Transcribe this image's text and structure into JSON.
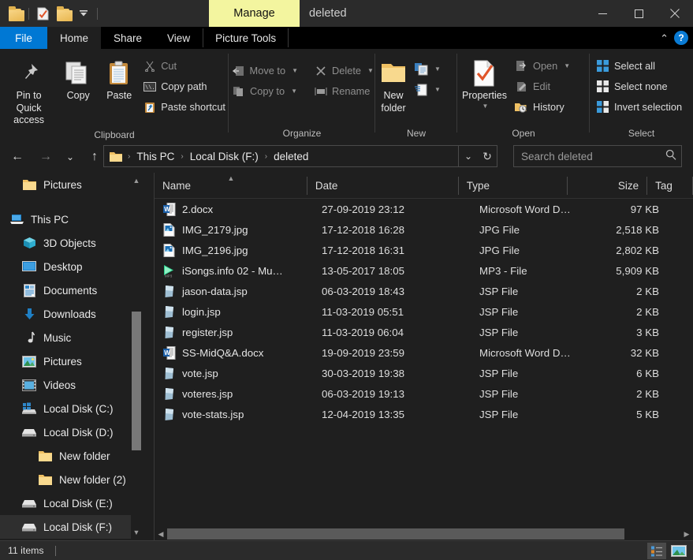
{
  "window": {
    "title": "deleted",
    "contextual_tab": "Manage",
    "quick_access": [
      {
        "name": "folder-icon",
        "label": "Folder"
      },
      {
        "name": "properties-icon",
        "label": "Properties"
      },
      {
        "name": "new-folder-icon",
        "label": "New folder"
      },
      {
        "name": "customize-qat-icon",
        "label": "Customize Quick Access Toolbar"
      }
    ],
    "controls": {
      "minimize": "Minimize",
      "maximize": "Maximize",
      "close": "Close"
    }
  },
  "tabs": [
    {
      "label": "File",
      "id": "file"
    },
    {
      "label": "Home",
      "id": "home"
    },
    {
      "label": "Share",
      "id": "share"
    },
    {
      "label": "View",
      "id": "view"
    },
    {
      "label": "Picture Tools",
      "id": "picture-tools"
    }
  ],
  "ribbon_right": {
    "collapse": "⌃",
    "help": "?"
  },
  "ribbon": {
    "groups": [
      {
        "label": "Clipboard",
        "big": [
          {
            "name": "pin-to-quick-access-button",
            "label": "Pin to Quick\naccess",
            "line1": "Pin to Quick",
            "line2": "access",
            "icon": "pin-icon"
          },
          {
            "name": "copy-button",
            "label": "Copy",
            "line1": "Copy",
            "line2": "",
            "icon": "copy-icon"
          },
          {
            "name": "paste-button",
            "label": "Paste",
            "line1": "Paste",
            "line2": "",
            "icon": "paste-icon"
          }
        ],
        "small": [
          {
            "name": "cut-button",
            "label": "Cut",
            "icon": "scissors-icon",
            "dim": true,
            "caret": false
          },
          {
            "name": "copy-path-button",
            "label": "Copy path",
            "icon": "copy-path-icon",
            "dim": false,
            "caret": false
          },
          {
            "name": "paste-shortcut-button",
            "label": "Paste shortcut",
            "icon": "paste-shortcut-icon",
            "dim": false,
            "caret": false
          }
        ]
      },
      {
        "label": "Organize",
        "big": [],
        "small": [
          {
            "name": "move-to-button",
            "label": "Move to",
            "icon": "move-to-icon",
            "dim": true,
            "caret": true
          },
          {
            "name": "copy-to-button",
            "label": "Copy to",
            "icon": "copy-to-icon",
            "dim": true,
            "caret": true
          },
          {
            "name": "delete-button",
            "label": "Delete",
            "icon": "delete-icon",
            "dim": true,
            "caret": true
          },
          {
            "name": "rename-button",
            "label": "Rename",
            "icon": "rename-icon",
            "dim": true,
            "caret": false
          }
        ]
      },
      {
        "label": "New",
        "big": [
          {
            "name": "new-folder-button",
            "label": "New folder",
            "line1": "New",
            "line2": "folder",
            "icon": "folder-icon"
          }
        ],
        "small": [
          {
            "name": "new-item-button",
            "label": "",
            "icon": "new-item-icon",
            "dim": false,
            "caret": true
          },
          {
            "name": "easy-access-button",
            "label": "",
            "icon": "easy-access-icon",
            "dim": false,
            "caret": true
          }
        ]
      },
      {
        "label": "Open",
        "big": [
          {
            "name": "properties-button",
            "label": "Properties",
            "line1": "Properties",
            "line2": "",
            "icon": "properties-icon"
          }
        ],
        "small": [
          {
            "name": "open-button",
            "label": "Open",
            "icon": "open-icon",
            "dim": true,
            "caret": true
          },
          {
            "name": "edit-button",
            "label": "Edit",
            "icon": "edit-icon",
            "dim": true,
            "caret": false
          },
          {
            "name": "history-button",
            "label": "History",
            "icon": "history-icon",
            "dim": false,
            "caret": false
          }
        ]
      },
      {
        "label": "Select",
        "big": [],
        "small": [
          {
            "name": "select-all-button",
            "label": "Select all",
            "icon": "select-all-icon",
            "dim": false,
            "caret": false
          },
          {
            "name": "select-none-button",
            "label": "Select none",
            "icon": "select-none-icon",
            "dim": false,
            "caret": false
          },
          {
            "name": "invert-selection-button",
            "label": "Invert selection",
            "icon": "invert-selection-icon",
            "dim": false,
            "caret": false
          }
        ]
      }
    ]
  },
  "address": {
    "back": "←",
    "forward": "→",
    "recent": "⌄",
    "up": "↑",
    "breadcrumbs": [
      "This PC",
      "Local Disk (F:)",
      "deleted"
    ],
    "separator": "›",
    "dropdown": "⌄",
    "refresh": "↻"
  },
  "search": {
    "placeholder": "Search deleted",
    "value": "",
    "icon": "search-icon"
  },
  "sidebar": {
    "items": [
      {
        "label": "Pictures",
        "icon": "folder-icon",
        "level": 1,
        "selected": false,
        "gap_after": true
      },
      {
        "label": "This PC",
        "icon": "this-pc-icon",
        "level": 0,
        "selected": false,
        "gap_after": false
      },
      {
        "label": "3D Objects",
        "icon": "3d-objects-icon",
        "level": 1,
        "selected": false,
        "gap_after": false
      },
      {
        "label": "Desktop",
        "icon": "desktop-icon",
        "level": 1,
        "selected": false,
        "gap_after": false
      },
      {
        "label": "Documents",
        "icon": "documents-icon",
        "level": 1,
        "selected": false,
        "gap_after": false
      },
      {
        "label": "Downloads",
        "icon": "downloads-icon",
        "level": 1,
        "selected": false,
        "gap_after": false
      },
      {
        "label": "Music",
        "icon": "music-icon",
        "level": 1,
        "selected": false,
        "gap_after": false
      },
      {
        "label": "Pictures",
        "icon": "pictures-icon",
        "level": 1,
        "selected": false,
        "gap_after": false
      },
      {
        "label": "Videos",
        "icon": "videos-icon",
        "level": 1,
        "selected": false,
        "gap_after": false
      },
      {
        "label": "Local Disk (C:)",
        "icon": "windows-drive-icon",
        "level": 1,
        "selected": false,
        "gap_after": false
      },
      {
        "label": "Local Disk (D:)",
        "icon": "drive-icon",
        "level": 1,
        "selected": false,
        "gap_after": false
      },
      {
        "label": "New folder",
        "icon": "folder-icon",
        "level": 2,
        "selected": false,
        "gap_after": false
      },
      {
        "label": "New folder (2)",
        "icon": "folder-icon",
        "level": 2,
        "selected": false,
        "gap_after": false
      },
      {
        "label": "Local Disk (E:)",
        "icon": "drive-icon",
        "level": 1,
        "selected": false,
        "gap_after": false
      },
      {
        "label": "Local Disk (F:)",
        "icon": "drive-icon",
        "level": 1,
        "selected": true,
        "gap_after": false
      }
    ]
  },
  "filelist": {
    "columns": [
      {
        "label": "Name",
        "key": "name",
        "sorted": "asc"
      },
      {
        "label": "Date",
        "key": "date",
        "sorted": ""
      },
      {
        "label": "Type",
        "key": "type",
        "sorted": ""
      },
      {
        "label": "Size",
        "key": "size",
        "sorted": ""
      },
      {
        "label": "Tag",
        "key": "tag",
        "sorted": ""
      }
    ],
    "rows": [
      {
        "name": "2.docx",
        "date": "27-09-2019 23:12",
        "type": "Microsoft Word D…",
        "size": "97 KB",
        "icon": "word-doc-icon"
      },
      {
        "name": "IMG_2179.jpg",
        "date": "17-12-2018 16:28",
        "type": "JPG File",
        "size": "2,518 KB",
        "icon": "image-file-icon"
      },
      {
        "name": "IMG_2196.jpg",
        "date": "17-12-2018 16:31",
        "type": "JPG File",
        "size": "2,802 KB",
        "icon": "image-file-icon"
      },
      {
        "name": "iSongs.info  02 - Mu…",
        "date": "13-05-2017 18:05",
        "type": "MP3 - File",
        "size": "5,909 KB",
        "icon": "media-play-icon"
      },
      {
        "name": "jason-data.jsp",
        "date": "06-03-2019 18:43",
        "type": "JSP File",
        "size": "2 KB",
        "icon": "jsp-file-icon"
      },
      {
        "name": "login.jsp",
        "date": "11-03-2019 05:51",
        "type": "JSP File",
        "size": "2 KB",
        "icon": "jsp-file-icon"
      },
      {
        "name": "register.jsp",
        "date": "11-03-2019 06:04",
        "type": "JSP File",
        "size": "3 KB",
        "icon": "jsp-file-icon"
      },
      {
        "name": "SS-MidQ&A.docx",
        "date": "19-09-2019 23:59",
        "type": "Microsoft Word D…",
        "size": "32 KB",
        "icon": "word-doc-icon"
      },
      {
        "name": "vote.jsp",
        "date": "30-03-2019 19:38",
        "type": "JSP File",
        "size": "6 KB",
        "icon": "jsp-file-icon"
      },
      {
        "name": "voteres.jsp",
        "date": "06-03-2019 19:13",
        "type": "JSP File",
        "size": "2 KB",
        "icon": "jsp-file-icon"
      },
      {
        "name": "vote-stats.jsp",
        "date": "12-04-2019 13:35",
        "type": "JSP File",
        "size": "5 KB",
        "icon": "jsp-file-icon"
      }
    ]
  },
  "statusbar": {
    "item_count": "11 items",
    "views": [
      {
        "name": "details-view-button",
        "label": "Details view",
        "active": true
      },
      {
        "name": "large-icons-view-button",
        "label": "Large icons view",
        "active": false
      }
    ]
  },
  "colors": {
    "accent": "#0078d4",
    "contextual_tab": "#f3f59f",
    "window_bg": "#1f1f1f",
    "titlebar_bg": "#2b2b2b",
    "tabbar_bg": "#000000",
    "selection": "#2f2f2f"
  }
}
